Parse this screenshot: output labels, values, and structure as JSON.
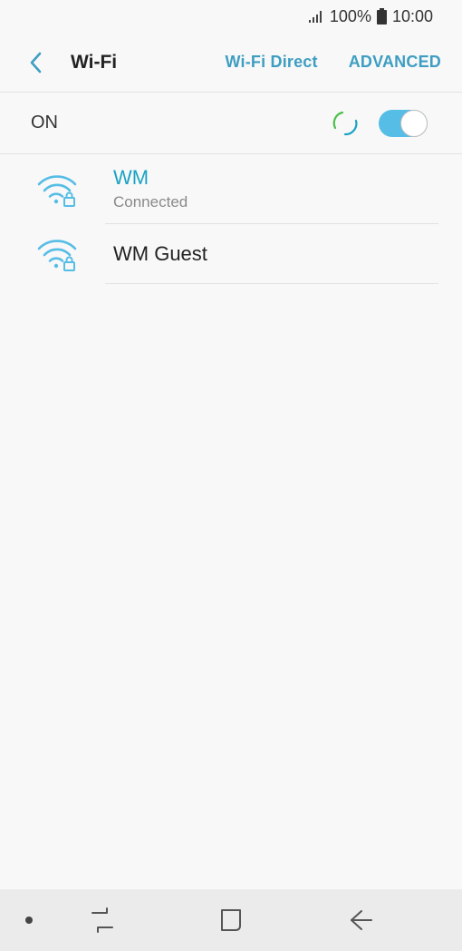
{
  "status_bar": {
    "battery_percent": "100%",
    "time": "10:00"
  },
  "app_bar": {
    "title": "Wi-Fi",
    "wifi_direct_label": "Wi-Fi Direct",
    "advanced_label": "ADVANCED"
  },
  "master_switch": {
    "label": "ON",
    "state": true
  },
  "networks": [
    {
      "name": "WM",
      "status": "Connected",
      "secured": true
    },
    {
      "name": "WM Guest",
      "status": "",
      "secured": true
    }
  ],
  "colors": {
    "accent": "#3e9ec2",
    "connected": "#1aa3c4",
    "toggle_on": "#56bde6",
    "wifi_icon": "#56bde6"
  }
}
